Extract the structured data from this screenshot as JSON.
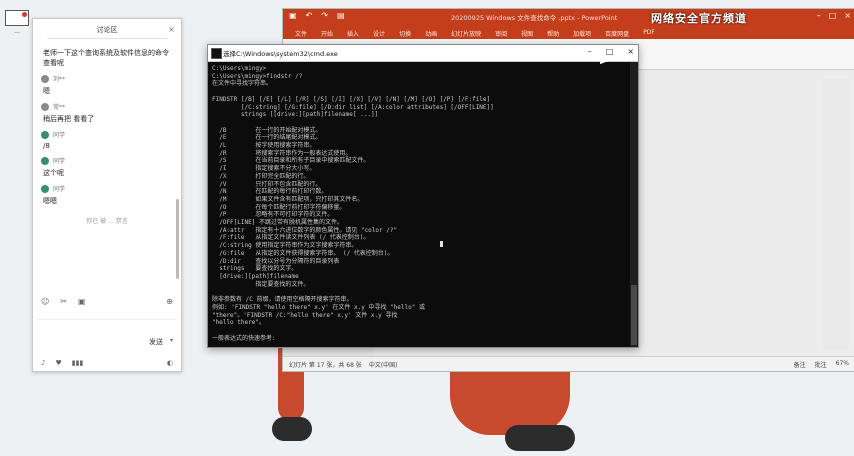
{
  "desktop": {
    "icon_label": "..."
  },
  "chat": {
    "title": "讨论区",
    "close": "×",
    "messages": [
      {
        "user": "",
        "text": "老师一下这个查询系统及软件信息的命令查看呢"
      },
      {
        "user": "刘**",
        "text": "嗯"
      },
      {
        "user": "常**",
        "text": "稍后再把 看看了"
      },
      {
        "user": "同学",
        "text": "/8"
      },
      {
        "user": "同学",
        "text": "这个呢"
      },
      {
        "user": "同学",
        "text": "嗯嗯"
      }
    ],
    "notice": "你已 被 ... 禁言",
    "send": "发送",
    "send_caret": "▾"
  },
  "ppt": {
    "filename": "20200925 Windows 文件查找命令 .pptx - PowerPoint",
    "user_banner": "网络安全官方频道",
    "tabs": [
      "文件",
      "开始",
      "插入",
      "设计",
      "切换",
      "动画",
      "幻灯片放映",
      "审阅",
      "视图",
      "帮助",
      "加载项",
      "百度网盘",
      "PDF"
    ],
    "status_left": [
      "幻灯片 第 17 张，共 68 张",
      "中文(中国)"
    ],
    "status_right": [
      "备注",
      "批注",
      "67%"
    ]
  },
  "cmd": {
    "title": "选择C:\\Windows\\system32\\cmd.exe",
    "lines": [
      "C:\\Users\\mingy>",
      "C:\\Users\\mingy>findstr /?",
      "在文件中寻找字符串。",
      "",
      "FINDSTR [/B] [/E] [/L] [/R] [/S] [/I] [/X] [/V] [/N] [/M] [/O] [/P] [/F:file]",
      "        [/C:string] [/G:file] [/D:dir list] [/A:color attributes] [/OFF[LINE]]",
      "        strings [[drive:][path]filename[ ...]]",
      "",
      "  /B        在一行的开始配对模式。",
      "  /E        在一行的结尾配对模式。",
      "  /L        按字使用搜索字符串。",
      "  /R        将搜索字符串作为一般表达式使用。",
      "  /S        在当前目录和所有子目录中搜索匹配文件。",
      "  /I        指定搜索不分大小写。",
      "  /X        打印完全匹配的行。",
      "  /V        只打印不包含匹配的行。",
      "  /N        在匹配的每行前打印行数。",
      "  /M        如果文件含有匹配项，只打印其文件名。",
      "  /O        在每个匹配行前打印字符偏移量。",
      "  /P        忽略有不可打印字符的文件。",
      "  /OFF[LINE] 不跳过带有脱机属性集的文件。",
      "  /A:attr   指定有十六进位数字的颜色属性。请见 \"color /?\"",
      "  /F:file   从指定文件读文件列表 (/ 代表控制台)。",
      "  /C:string 使用指定字符串作为文字搜索字符串。",
      "  /G:file   从指定的文件获得搜索字符串。 (/ 代表控制台)。",
      "  /D:dir    查找以分号为分隔符的目录列表",
      "  strings   要查找的文字。",
      "  [drive:][path]filename",
      "            指定要查找的文件。",
      "",
      "除非参数有 /C 前缀，请使用空格隔开搜索字符串。",
      "例如: 'FINDSTR \"hello there\" x.y' 在文件 x.y 中寻找 \"hello\" 或",
      "\"there\"。'FINDSTR /C:\"hello there\" x.y' 文件 x.y 寻找",
      "\"hello there\"。",
      "",
      "一般表达式的快速参考:"
    ]
  }
}
